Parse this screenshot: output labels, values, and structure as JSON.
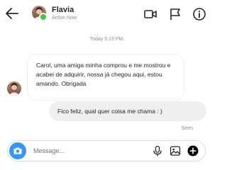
{
  "header": {
    "contact_name": "Flavia",
    "status": "Active Now",
    "icons": [
      "back-arrow-icon",
      "video-camera-icon",
      "flag-icon",
      "info-icon"
    ]
  },
  "conversation": {
    "timestamp": "Today 5:13 PM",
    "messages": [
      {
        "direction": "incoming",
        "text": "Carol, uma amiga minha comprou e me mostrou e acabei de adquirir, nossa já chegou aqui, estou amando. Obrigada"
      },
      {
        "direction": "outgoing",
        "text": "Fico feliz, qual quer coisa me chama : )"
      }
    ],
    "seen_label": "Seen"
  },
  "composer": {
    "placeholder": "Message...",
    "icons": [
      "camera-icon",
      "microphone-icon",
      "image-icon",
      "plus-icon"
    ]
  },
  "colors": {
    "accent": "#3797f0",
    "presence": "#3ec93e",
    "outgoing_bubble": "#efefef",
    "secondary_text": "#8e8e8e"
  }
}
